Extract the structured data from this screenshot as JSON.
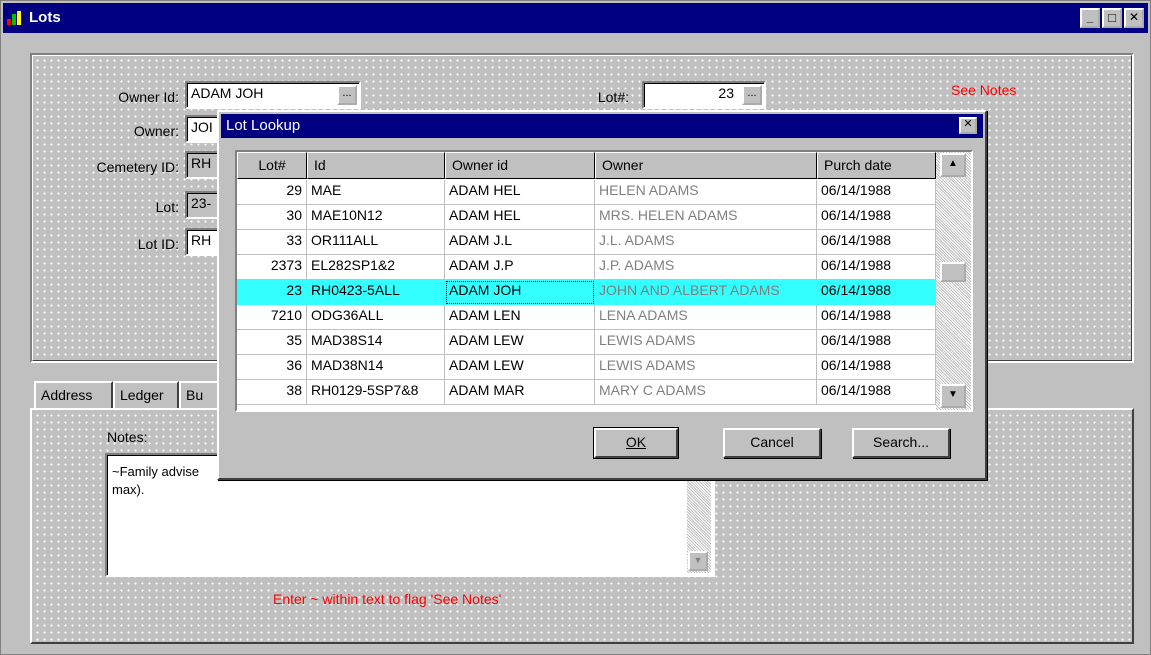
{
  "window": {
    "title": "Lots",
    "minimize": "_",
    "maximize": "□",
    "close": "✕"
  },
  "form": {
    "owner_id_label": "Owner Id:",
    "owner_id_value": "ADAM JOH",
    "lot_num_label": "Lot#:",
    "lot_num_value": "23",
    "see_notes": "See Notes",
    "owner_label": "Owner:",
    "owner_value_visible": "JOI",
    "cemetery_id_label": "Cemetery ID:",
    "cemetery_id_value_visible": "RH",
    "lot_label": "Lot:",
    "lot_value_visible": "23-",
    "lot_id_label": "Lot ID:",
    "lot_id_value_visible": "RH",
    "browse": "..."
  },
  "tabs": [
    {
      "label": "Address"
    },
    {
      "label": "Ledger"
    },
    {
      "label": "Bu"
    }
  ],
  "notes": {
    "label": "Notes:",
    "text_line1": "~Family advise",
    "text_line2": "max).",
    "hint": "Enter ~ within text to flag 'See Notes'"
  },
  "lookup": {
    "title": "Lot Lookup",
    "columns": [
      "Lot#",
      "Id",
      "Owner id",
      "Owner",
      "Purch date"
    ],
    "rows": [
      {
        "lot": "29",
        "id": "MAE",
        "owner_id": "ADAM HEL",
        "owner": "HELEN ADAMS",
        "date": "06/14/1988"
      },
      {
        "lot": "30",
        "id": "MAE10N12",
        "owner_id": "ADAM HEL",
        "owner": "MRS. HELEN ADAMS",
        "date": "06/14/1988"
      },
      {
        "lot": "33",
        "id": "OR111ALL",
        "owner_id": "ADAM J.L",
        "owner": "J.L. ADAMS",
        "date": "06/14/1988"
      },
      {
        "lot": "2373",
        "id": "EL282SP1&2",
        "owner_id": "ADAM J.P",
        "owner": "J.P. ADAMS",
        "date": "06/14/1988"
      },
      {
        "lot": "23",
        "id": "RH0423-5ALL",
        "owner_id": "ADAM JOH",
        "owner": "JOHN AND ALBERT ADAMS",
        "date": "06/14/1988"
      },
      {
        "lot": "7210",
        "id": "ODG36ALL",
        "owner_id": "ADAM LEN",
        "owner": "LENA ADAMS",
        "date": "06/14/1988"
      },
      {
        "lot": "35",
        "id": "MAD38S14",
        "owner_id": "ADAM LEW",
        "owner": "LEWIS ADAMS",
        "date": "06/14/1988"
      },
      {
        "lot": "36",
        "id": "MAD38N14",
        "owner_id": "ADAM LEW",
        "owner": "LEWIS ADAMS",
        "date": "06/14/1988"
      },
      {
        "lot": "38",
        "id": "RH0129-5SP7&8",
        "owner_id": "ADAM MAR",
        "owner": "MARY C ADAMS",
        "date": "06/14/1988"
      }
    ],
    "selected_index": 4,
    "ok_label": "OK",
    "cancel_label": "Cancel",
    "search_label": "Search...",
    "scroll_up": "▲",
    "scroll_down": "▼"
  },
  "colors": {
    "titlebar": "#000080",
    "selection": "#33ffff",
    "warning_text": "#ff0000"
  }
}
